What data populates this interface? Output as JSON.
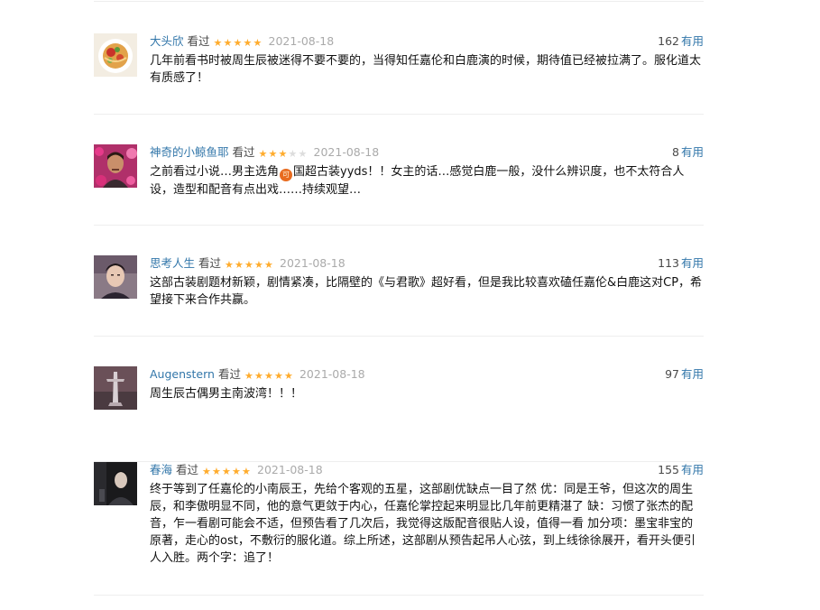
{
  "comments": [
    {
      "user": "大头欣",
      "status": "看过",
      "rating": 5,
      "date": "2021-08-18",
      "votes": "162",
      "useful_label": "有用",
      "text": "几年前看书时被周生辰被迷得不要不要的，当得知任嘉伦和白鹿演的时候，期待值已经被拉满了。服化道太有质感了！"
    },
    {
      "user": "神奇的小鲸鱼耶",
      "status": "看过",
      "rating": 3,
      "date": "2021-08-18",
      "votes": "8",
      "useful_label": "有用",
      "text_before_icon": "之前看过小说…男主选角",
      "inline_icon": "可",
      "text_after_icon": "国超古装yyds！！女主的话…感觉白鹿一般，没什么辨识度，也不太符合人设，造型和配音有点出戏……持续观望…"
    },
    {
      "user": "思考人生",
      "status": "看过",
      "rating": 5,
      "date": "2021-08-18",
      "votes": "113",
      "useful_label": "有用",
      "text": "这部古装剧题材新颖，剧情紧凑，比隔壁的《与君歌》超好看，但是我比较喜欢磕任嘉伦&白鹿这对CP，希望接下来合作共赢。"
    },
    {
      "user": "Augenstern",
      "status": "看过",
      "rating": 5,
      "date": "2021-08-18",
      "votes": "97",
      "useful_label": "有用",
      "text": "周生辰古偶男主南波湾！！！"
    },
    {
      "user": "春海",
      "status": "看过",
      "rating": 5,
      "date": "2021-08-18",
      "votes": "155",
      "useful_label": "有用",
      "text": "终于等到了任嘉伦的小南辰王，先给个客观的五星，这部剧优缺点一目了然 优：同是王爷，但这次的周生辰，和李傲明显不同，他的意气更敛于内心，任嘉伦掌控起来明显比几年前更精湛了 缺：习惯了张杰的配音，乍一看剧可能会不适，但预告看了几次后，我觉得这版配音很贴人设，值得一看 加分项：墨宝非宝的原著，走心的ost，不敷衍的服化道。综上所述，这部剧从预告起吊人心弦，到上线徐徐展开，看开头便引人入胜。两个字：追了！"
    }
  ],
  "colors": {
    "link": "#3377aa",
    "star_on": "#ffac2d",
    "star_off": "#dddddd",
    "date": "#aaaaaa",
    "divider": "#eeeeee"
  }
}
